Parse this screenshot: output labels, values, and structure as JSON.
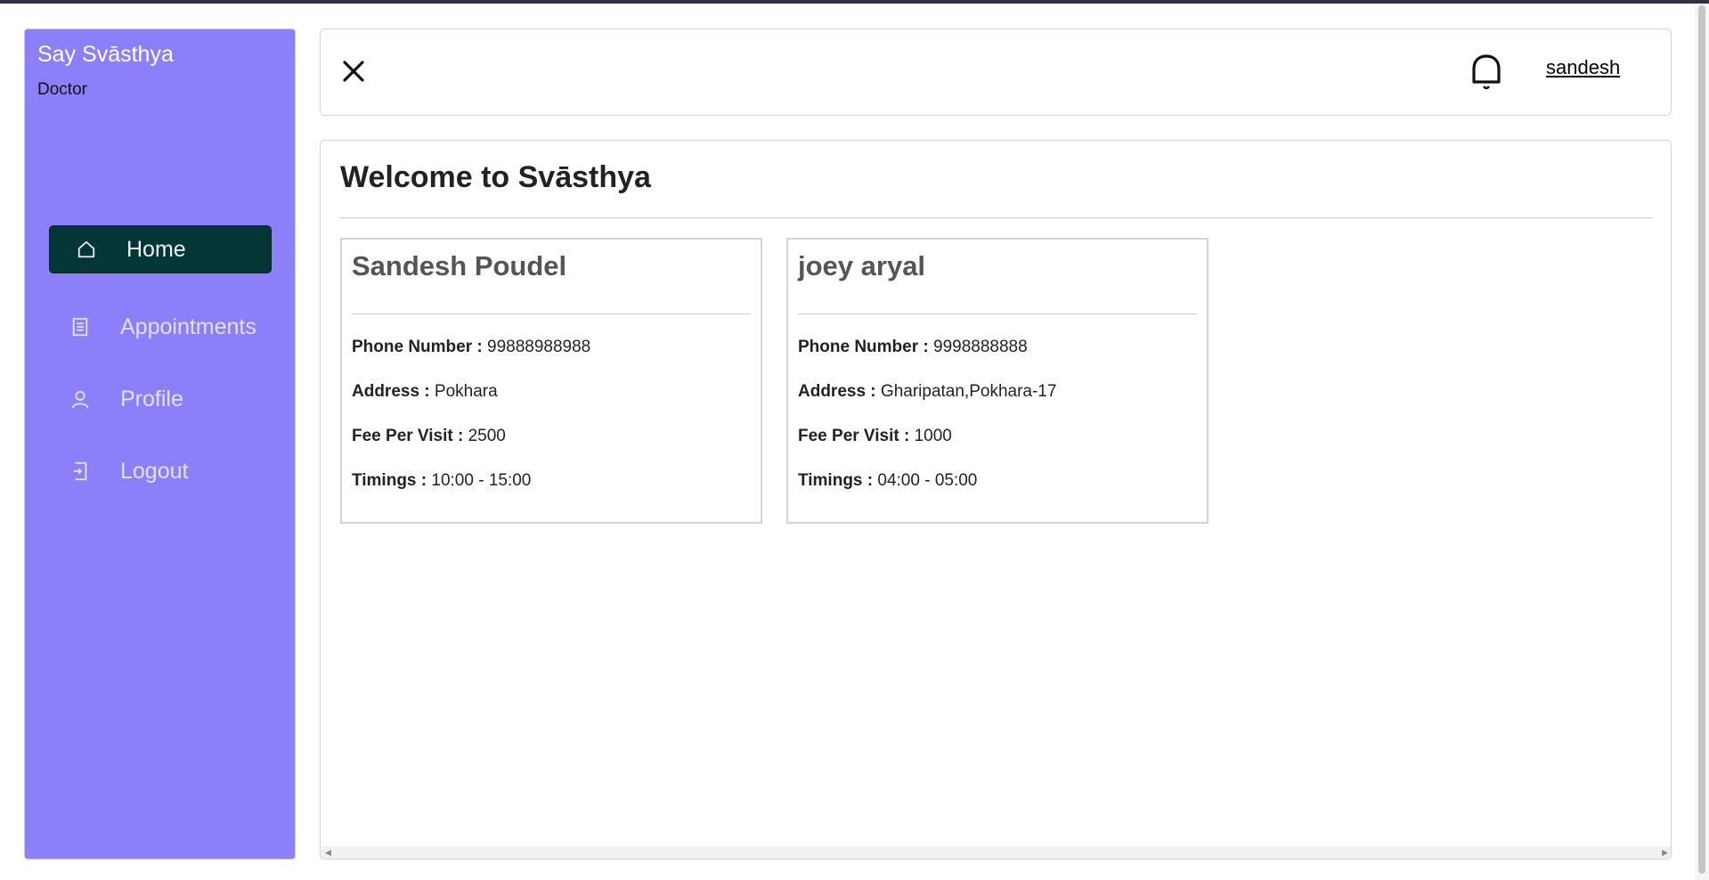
{
  "sidebar": {
    "brand": "Say Svāsthya",
    "role": "Doctor",
    "items": [
      {
        "label": "Home",
        "icon": "home-icon",
        "active": true
      },
      {
        "label": "Appointments",
        "icon": "document-list-icon",
        "active": false
      },
      {
        "label": "Profile",
        "icon": "user-icon",
        "active": false
      },
      {
        "label": "Logout",
        "icon": "logout-icon",
        "active": false
      }
    ]
  },
  "header": {
    "close_icon": "close-icon",
    "notification_icon": "bell-icon",
    "username": "sandesh"
  },
  "main": {
    "title": "Welcome to Svāsthya",
    "doctors": [
      {
        "name": "Sandesh Poudel",
        "phone_label": "Phone Number :",
        "phone": "99888988988",
        "address_label": "Address :",
        "address": "Pokhara",
        "fee_label": "Fee Per Visit :",
        "fee": "2500",
        "timings_label": "Timings :",
        "timings": "10:00 - 15:00"
      },
      {
        "name": "joey aryal",
        "phone_label": "Phone Number :",
        "phone": "9998888888",
        "address_label": "Address :",
        "address": "Gharipatan,Pokhara-17",
        "fee_label": "Fee Per Visit :",
        "fee": "1000",
        "timings_label": "Timings :",
        "timings": "04:00 - 05:00"
      }
    ]
  },
  "colors": {
    "sidebar_bg": "#8b80f9",
    "active_item_bg": "#053637",
    "topbar": "#2d3340"
  }
}
